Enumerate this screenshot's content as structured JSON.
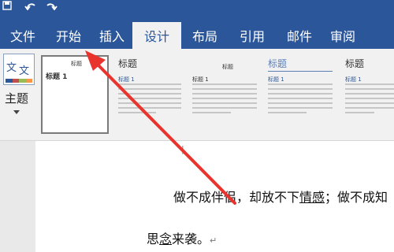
{
  "ribbon_tabs": [
    "文件",
    "开始",
    "插入",
    "设计",
    "布局",
    "引用",
    "邮件",
    "审阅"
  ],
  "active_tab": "设计",
  "theme_button": {
    "icon_text_a": "文",
    "icon_text_b": "文",
    "label": "主题"
  },
  "style_gallery": [
    {
      "tiny_title": "标题",
      "heading": "标题 1"
    },
    {
      "heading": "标题",
      "sub_heading": "标题 1"
    },
    {
      "tiny_title": "标题",
      "sub_heading": "标题 1"
    },
    {
      "heading": "标题",
      "sub_heading": "标题 1"
    },
    {
      "heading": "标题",
      "sub_heading": "标题 1"
    }
  ],
  "document": {
    "line1_a": "做不成伴侣，却放不下",
    "line1_b": "情感",
    "line1_c": "；做不成知",
    "line2_a": "思",
    "line2_b": "念",
    "line2_c": "来袭。",
    "paragraph_mark": "↵"
  },
  "colors": {
    "accent": "#2b579a",
    "annotation_arrow": "#e8342c"
  }
}
